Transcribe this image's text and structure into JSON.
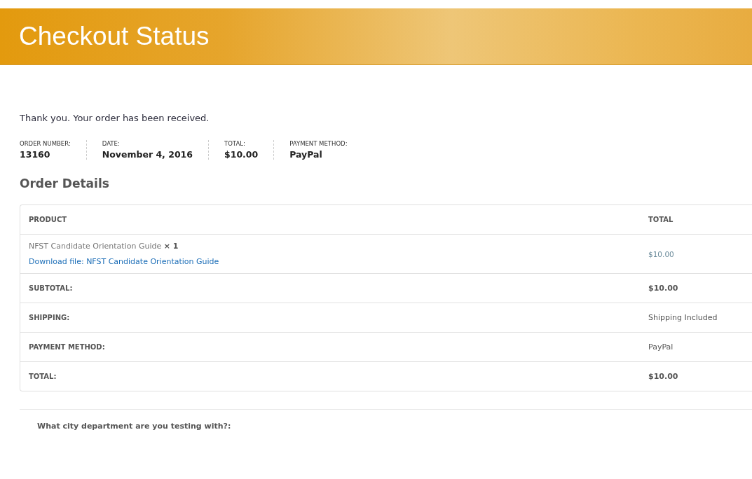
{
  "header": {
    "title": "Checkout Status"
  },
  "notice": "Thank you. Your order has been received.",
  "overview": [
    {
      "label": "ORDER NUMBER:",
      "value": "13160"
    },
    {
      "label": "DATE:",
      "value": "November 4, 2016"
    },
    {
      "label": "TOTAL:",
      "value": "$10.00"
    },
    {
      "label": "PAYMENT METHOD:",
      "value": "PayPal"
    }
  ],
  "order_details": {
    "title": "Order Details",
    "columns": [
      "PRODUCT",
      "TOTAL"
    ],
    "items": [
      {
        "product": "NFST Candidate Orientation Guide **× 1**",
        "download_link": "Download file: NFST Candidate Orientation Guide",
        "total": "$10.00"
      }
    ],
    "totals": [
      {
        "label": "SUBTOTAL:",
        "value": "$10.00"
      },
      {
        "label": "SHIPPING:",
        "value": "Shipping Included"
      },
      {
        "label": "PAYMENT METHOD:",
        "value": "PayPal"
      },
      {
        "label": "TOTAL:",
        "value": "$10.00"
      }
    ]
  },
  "custom_field": {
    "label": "What city department are you testing with?:"
  }
}
